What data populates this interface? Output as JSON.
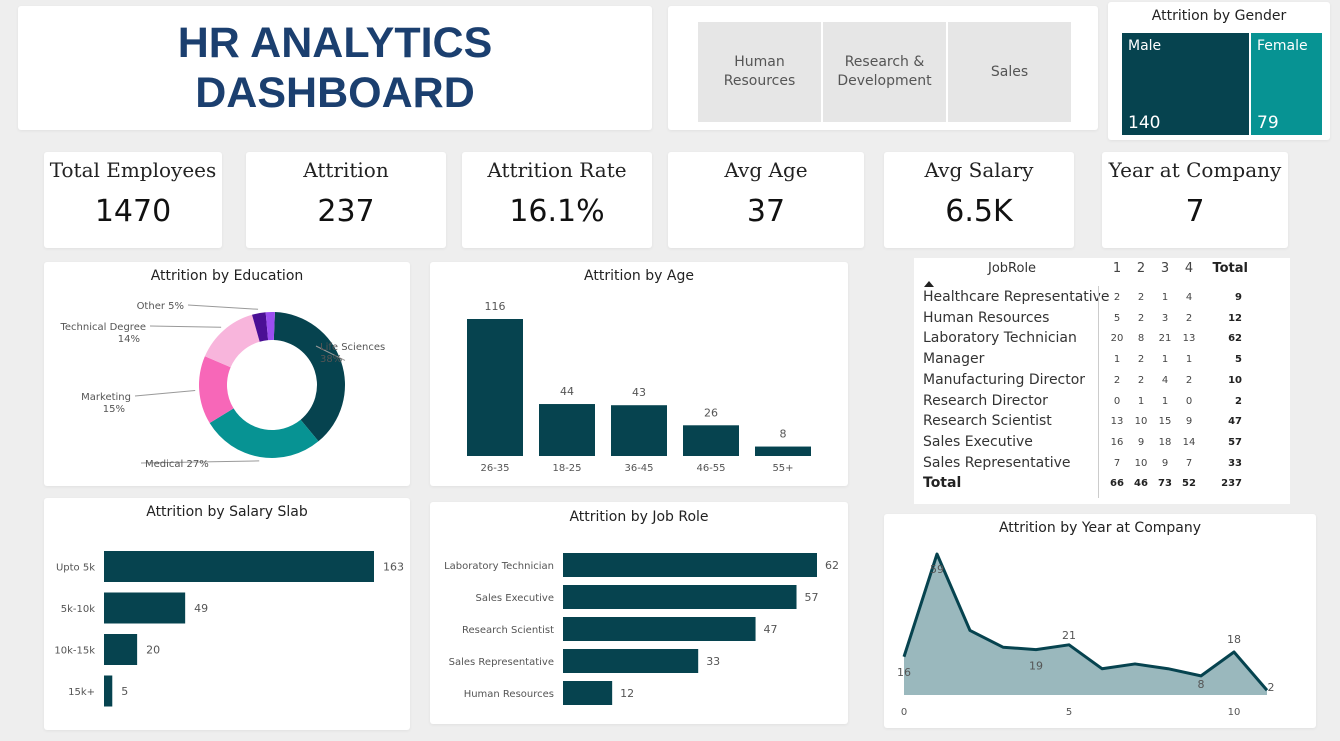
{
  "header": {
    "title": "HR ANALYTICS DASHBOARD"
  },
  "slicer": {
    "items": [
      "Human Resources",
      "Research & Development",
      "Sales"
    ]
  },
  "colors": {
    "dark_teal": "#06434f",
    "teal": "#079393",
    "pink_hot": "#f767b8",
    "pink_light": "#f8b5dc",
    "purple_dark": "#4b0f95",
    "purple": "#9b4ef0",
    "area_fill": "#9ab8bd",
    "slicer_bg": "#e6e6e6",
    "title_blue": "#1b3f6f"
  },
  "gender": {
    "title": "Attrition by Gender",
    "items": [
      {
        "label": "Male",
        "value": 140
      },
      {
        "label": "Female",
        "value": 79
      }
    ]
  },
  "kpis": [
    {
      "label": "Total Employees",
      "value": "1470"
    },
    {
      "label": "Attrition",
      "value": "237"
    },
    {
      "label": "Attrition Rate",
      "value": "16.1%"
    },
    {
      "label": "Avg Age",
      "value": "37"
    },
    {
      "label": "Avg Salary",
      "value": "6.5K"
    },
    {
      "label": "Year at Company",
      "value": "7"
    }
  ],
  "matrix": {
    "header": {
      "name": "JobRole",
      "cols": [
        "1",
        "2",
        "3",
        "4"
      ],
      "total": "Total"
    },
    "rows": [
      {
        "name": "Healthcare Representative",
        "cells": [
          "2",
          "2",
          "1",
          "4"
        ],
        "total": "9"
      },
      {
        "name": "Human Resources",
        "cells": [
          "5",
          "2",
          "3",
          "2"
        ],
        "total": "12"
      },
      {
        "name": "Laboratory Technician",
        "cells": [
          "20",
          "8",
          "21",
          "13"
        ],
        "total": "62"
      },
      {
        "name": "Manager",
        "cells": [
          "1",
          "2",
          "1",
          "1"
        ],
        "total": "5"
      },
      {
        "name": "Manufacturing Director",
        "cells": [
          "2",
          "2",
          "4",
          "2"
        ],
        "total": "10"
      },
      {
        "name": "Research Director",
        "cells": [
          "0",
          "1",
          "1",
          "0"
        ],
        "total": "2"
      },
      {
        "name": "Research Scientist",
        "cells": [
          "13",
          "10",
          "15",
          "9"
        ],
        "total": "47"
      },
      {
        "name": "Sales Executive",
        "cells": [
          "16",
          "9",
          "18",
          "14"
        ],
        "total": "57"
      },
      {
        "name": "Sales Representative",
        "cells": [
          "7",
          "10",
          "9",
          "7"
        ],
        "total": "33"
      }
    ],
    "total_row": {
      "name": "Total",
      "cells": [
        "66",
        "46",
        "73",
        "52"
      ],
      "total": "237"
    }
  },
  "chart_data": [
    {
      "type": "pie",
      "title": "Attrition by Education",
      "donut": true,
      "slices": [
        {
          "label": "Life Sciences",
          "value": 38,
          "value_label": "38%",
          "color": "#06434f"
        },
        {
          "label": "Medical",
          "value": 27,
          "value_label": "27%",
          "color": "#079393"
        },
        {
          "label": "Marketing",
          "value": 15,
          "value_label": "15%",
          "color": "#f767b8"
        },
        {
          "label": "Technical Degree",
          "value": 14,
          "value_label": "14%",
          "color": "#f8b5dc"
        },
        {
          "label": "Other",
          "value": 3,
          "value_label": "5%",
          "color": "#4b0f95"
        },
        {
          "label": "",
          "value": 2,
          "value_label": "",
          "color": "#9b4ef0"
        }
      ]
    },
    {
      "type": "bar",
      "title": "Attrition by Age",
      "categories": [
        "26-35",
        "18-25",
        "36-45",
        "46-55",
        "55+"
      ],
      "values": [
        116,
        44,
        43,
        26,
        8
      ],
      "ylim": [
        0,
        116
      ]
    },
    {
      "type": "bar",
      "orientation": "horizontal",
      "title": "Attrition by Salary Slab",
      "categories": [
        "Upto 5k",
        "5k-10k",
        "10k-15k",
        "15k+"
      ],
      "values": [
        163,
        49,
        20,
        5
      ],
      "xlim": [
        0,
        163
      ]
    },
    {
      "type": "bar",
      "orientation": "horizontal",
      "title": "Attrition by Job Role",
      "categories": [
        "Laboratory Technician",
        "Sales Executive",
        "Research Scientist",
        "Sales Representative",
        "Human Resources"
      ],
      "values": [
        62,
        57,
        47,
        33,
        12
      ],
      "xlim": [
        0,
        62
      ]
    },
    {
      "type": "area",
      "title": "Attrition by Year at Company",
      "x": [
        0,
        1,
        2,
        3,
        4,
        5,
        6,
        7,
        8,
        9,
        10,
        11
      ],
      "y": [
        16,
        59,
        27,
        20,
        19,
        21,
        11,
        13,
        11,
        8,
        18,
        2
      ],
      "point_labels": {
        "0": "16",
        "1": "59",
        "4": "19",
        "5": "21",
        "9": "8",
        "10": "18",
        "11": "2"
      },
      "x_ticks": [
        "0",
        "5",
        "10"
      ],
      "ylim": [
        0,
        59
      ]
    }
  ]
}
